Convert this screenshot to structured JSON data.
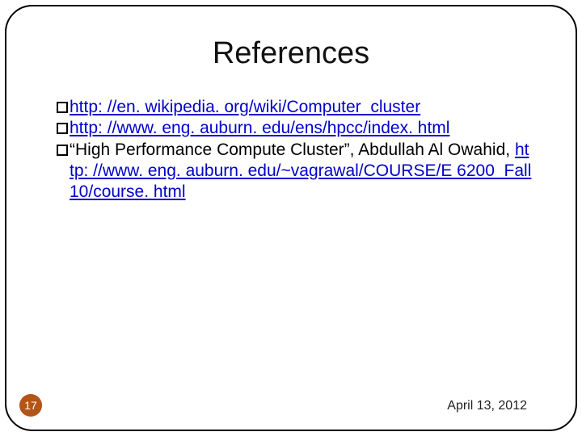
{
  "title": "References",
  "refs": {
    "r1": "http: //en. wikipedia. org/wiki/Computer_cluster",
    "r2": "http: //www. eng. auburn. edu/ens/hpcc/index. html",
    "r3_quote": "“High Performance Compute Cluster”,",
    "r3_name": " Abdullah Al Owahid, ",
    "r3_link": "http: //www. eng. auburn. edu/~vagrawal/COURSE/E 6200_Fall 10/course. html"
  },
  "page_number": "17",
  "date": "April 13, 2012"
}
